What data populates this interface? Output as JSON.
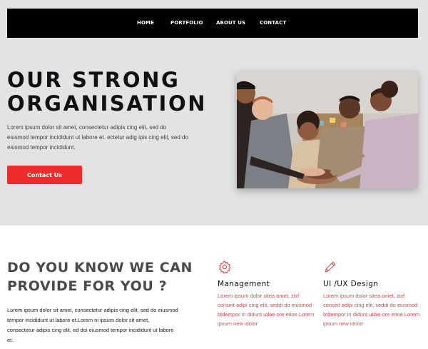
{
  "nav": {
    "items": [
      "HOME",
      "PORTFOLIO",
      "ABOUT US",
      "CONTACT"
    ]
  },
  "hero": {
    "title_line1": "OUR STRONG",
    "title_line2": "ORGANISATION",
    "description": "Lorem ipsum dolor sit amet, consectetur adipis cing elit, sed do eiusmod tempor incididunt ut labore et. ectetur adig ipis cing elit, sed do eiusmod tempor incididunt.",
    "button_label": "Contact Us",
    "image_icon": "team-hands-stacked-photo"
  },
  "intro": {
    "title": "DO YOU KNOW WE CAN PROVIDE FOR YOU ?",
    "description": "Lorem ipsum dolor sit amet, consectetur adipis cing elit, sed do eiusmod tempor incididunt ut labore et.Lorem ni ipsum dolor sit amet, consectetur adipis cing elit, ed doi eiusmod tempor incididunt ut labore et."
  },
  "services": [
    {
      "icon": "gear-icon",
      "title": "Management",
      "description": "Lorem ipsum dolor sitea amet, zixf conseit adipi cing elit, seddi do eiusmod btdempor in didunt utlae ore etioe.Lorem ipsum new idolor"
    },
    {
      "icon": "pencil-icon",
      "title": "UI /UX Design",
      "description": "Lorem ipsum dolor sitea amet, zixf conseit adipi cing elit, seddi do eiusmod btdempor in didunt utlae ore etioe.Lorem ipsum new idolor"
    }
  ],
  "colors": {
    "accent": "#ef2b2b",
    "hero_bg": "#e3e3e5",
    "nav_bg": "#000000"
  }
}
